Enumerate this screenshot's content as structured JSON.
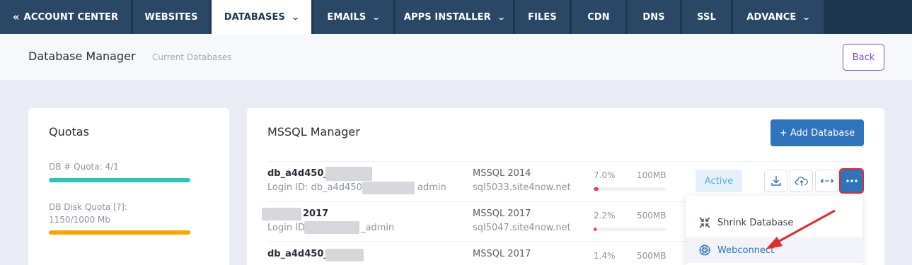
{
  "topnav": {
    "tabs": [
      {
        "label": "ACCOUNT CENTER"
      },
      {
        "label": "WEBSITES"
      },
      {
        "label": "DATABASES"
      },
      {
        "label": "EMAILS"
      },
      {
        "label": "APPS INSTALLER"
      },
      {
        "label": "FILES"
      },
      {
        "label": "CDN"
      },
      {
        "label": "DNS"
      },
      {
        "label": "SSL"
      },
      {
        "label": "ADVANCE"
      }
    ],
    "active_tab": "DATABASES"
  },
  "header": {
    "title": "Database Manager",
    "subtitle": "Current Databases",
    "back_label": "Back"
  },
  "quotas": {
    "title": "Quotas",
    "db_quota_label": "DB # Quota: 4/1",
    "db_quota_fraction": 1.0,
    "disk_quota_label": "DB Disk Quota [?]:",
    "disk_quota_value": "1150/1000 Mb",
    "disk_quota_fraction": 1.0
  },
  "manager": {
    "title": "MSSQL Manager",
    "add_label": "+ Add Database",
    "rows": [
      {
        "name": "db_a4d450_",
        "login": "Login ID: db_a4d450_",
        "login_suffix": "admin",
        "version": "MSSQL 2014",
        "server": "sql5033.site4now.net",
        "usage_pct": "7.0%",
        "usage_fraction": 0.07,
        "size": "100MB"
      },
      {
        "name": "2017",
        "login": "Login ID",
        "login_suffix": "_admin",
        "version": "MSSQL 2017",
        "server": "sql5047.site4now.net",
        "usage_pct": "2.2%",
        "usage_fraction": 0.022,
        "size": "500MB"
      },
      {
        "name": "db_a4d450_",
        "login": "",
        "login_suffix": "",
        "version": "MSSQL 2017",
        "server": "",
        "usage_pct": "1.4%",
        "usage_fraction": 0.014,
        "size": "500MB"
      }
    ],
    "status": "Active"
  },
  "dropdown": {
    "items": [
      {
        "label": "Shrink Database",
        "color": "#3e4150"
      },
      {
        "label": "Webconnect",
        "color": "#2f73bc"
      }
    ]
  },
  "colors": {
    "nav_bg": "#1d3650",
    "accent_blue": "#2f73bc",
    "quota_teal": "#2ec4b6",
    "quota_orange": "#f7a600",
    "usage_red": "#ea3b57",
    "annotation_red": "#e42a2a"
  }
}
